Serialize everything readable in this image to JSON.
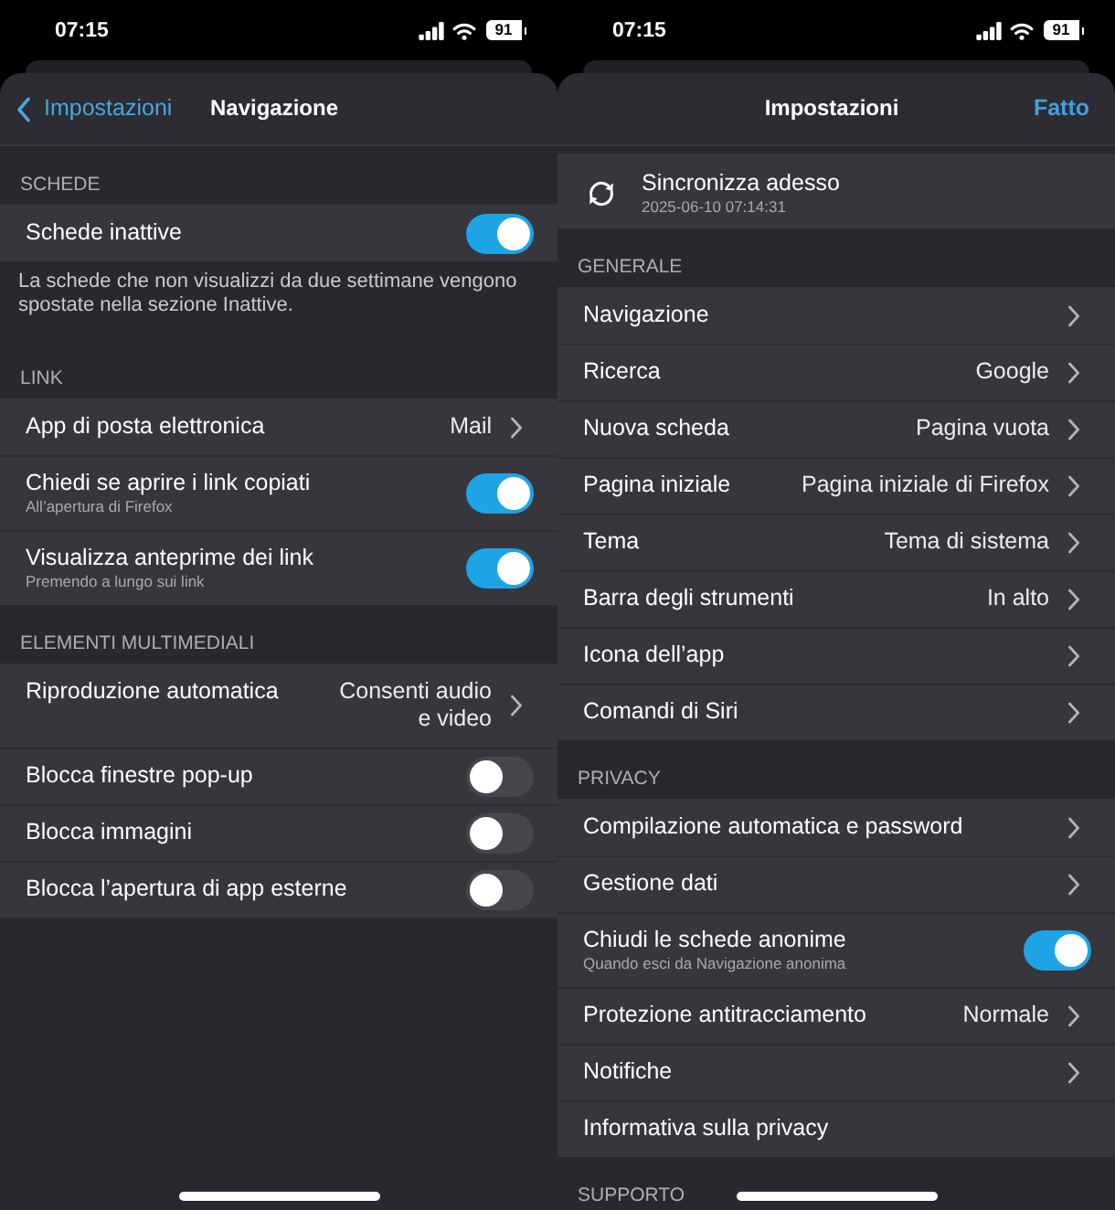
{
  "screens": [
    {
      "status_bar": {
        "time": "07:15",
        "battery": "91"
      },
      "nav_bar": {
        "back": "Impostazioni",
        "title": "Navigazione"
      },
      "sections": [
        {
          "header": "SCHEDE",
          "rows": [
            {
              "kind": "toggle",
              "label": "Schede inattive",
              "on": true
            }
          ],
          "footer": "La schede che non visualizzi da due settimane vengono spostate nella sezione Inattive."
        },
        {
          "header": "LINK",
          "rows": [
            {
              "kind": "link",
              "label": "App di posta elettronica",
              "value": "Mail"
            },
            {
              "kind": "toggle",
              "label": "Chiedi se aprire i link copiati",
              "subtitle": "All’apertura di Firefox",
              "on": true
            },
            {
              "kind": "toggle",
              "label": "Visualizza anteprime dei link",
              "subtitle": "Premendo a lungo sui link",
              "on": true
            }
          ]
        },
        {
          "header": "ELEMENTI MULTIMEDIALI",
          "rows": [
            {
              "kind": "link",
              "label": "Riproduzione automatica",
              "value": "Consenti audio\ne video"
            },
            {
              "kind": "toggle",
              "label": "Blocca finestre pop-up",
              "on": false
            },
            {
              "kind": "toggle",
              "label": "Blocca immagini",
              "on": false
            },
            {
              "kind": "toggle",
              "label": "Blocca l’apertura di app esterne",
              "on": false
            }
          ]
        }
      ]
    },
    {
      "status_bar": {
        "time": "07:15",
        "battery": "91"
      },
      "nav_bar": {
        "title": "Impostazioni",
        "action": "Fatto"
      },
      "sections": [
        {
          "rows": [
            {
              "kind": "sync",
              "label": "Sincronizza adesso",
              "subtitle": "2025-06-10 07:14:31"
            }
          ]
        },
        {
          "header": "GENERALE",
          "rows": [
            {
              "kind": "link",
              "label": "Navigazione"
            },
            {
              "kind": "link",
              "label": "Ricerca",
              "value": "Google"
            },
            {
              "kind": "link",
              "label": "Nuova scheda",
              "value": "Pagina vuota"
            },
            {
              "kind": "link",
              "label": "Pagina iniziale",
              "value": "Pagina iniziale di Firefox"
            },
            {
              "kind": "link",
              "label": "Tema",
              "value": "Tema di sistema"
            },
            {
              "kind": "link",
              "label": "Barra degli strumenti",
              "value": "In alto"
            },
            {
              "kind": "link",
              "label": "Icona dell’app"
            },
            {
              "kind": "link",
              "label": "Comandi di Siri"
            }
          ]
        },
        {
          "header": "PRIVACY",
          "rows": [
            {
              "kind": "link",
              "label": "Compilazione automatica e password"
            },
            {
              "kind": "link",
              "label": "Gestione dati"
            },
            {
              "kind": "toggle",
              "label": "Chiudi le schede anonime",
              "subtitle": "Quando esci da Navigazione anonima",
              "on": true
            },
            {
              "kind": "link",
              "label": "Protezione antitracciamento",
              "value": "Normale"
            },
            {
              "kind": "link",
              "label": "Notifiche"
            },
            {
              "kind": "plain",
              "label": "Informativa sulla privacy"
            }
          ]
        },
        {
          "header": "SUPPORTO"
        }
      ]
    }
  ]
}
